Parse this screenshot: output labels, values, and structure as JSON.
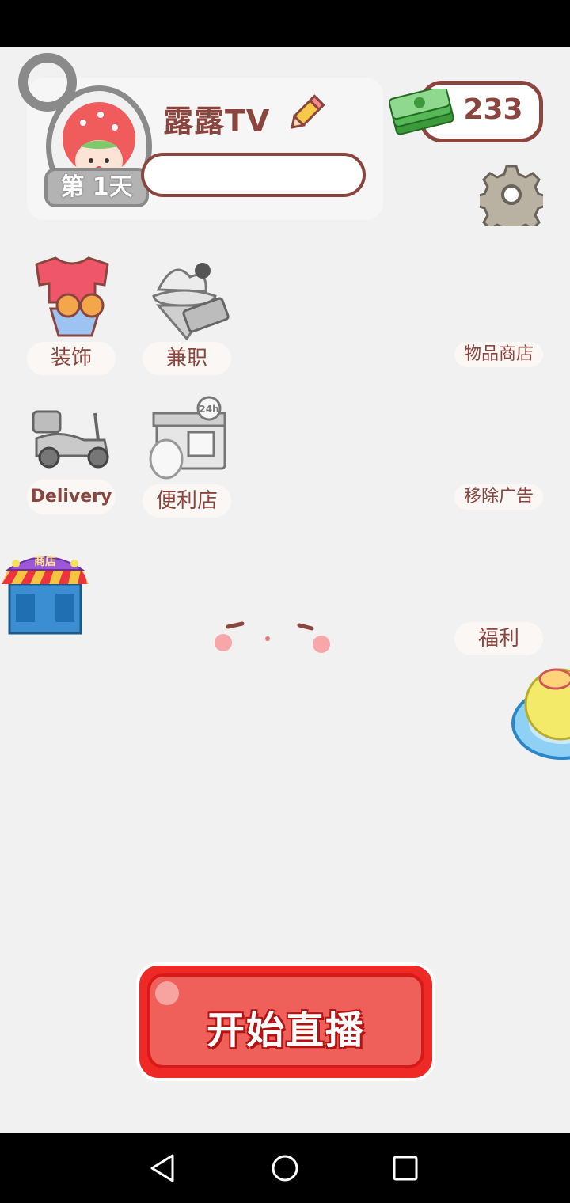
{
  "profile": {
    "name": "露露TV",
    "day_label": "第 1天"
  },
  "currency": {
    "amount": "233"
  },
  "tiles": [
    {
      "label": "装饰"
    },
    {
      "label": "兼职"
    },
    {
      "label": "Delivery"
    },
    {
      "label": "便利店"
    }
  ],
  "side_buttons": {
    "item_shop": "物品商店",
    "remove_ads": "移除广告",
    "welfare": "福利"
  },
  "shop_sign": "商店",
  "start_button": "开始直播",
  "colors": {
    "brand_brown": "#8a453f",
    "start_red": "#ef2a26",
    "background": "#f1f1f1"
  }
}
